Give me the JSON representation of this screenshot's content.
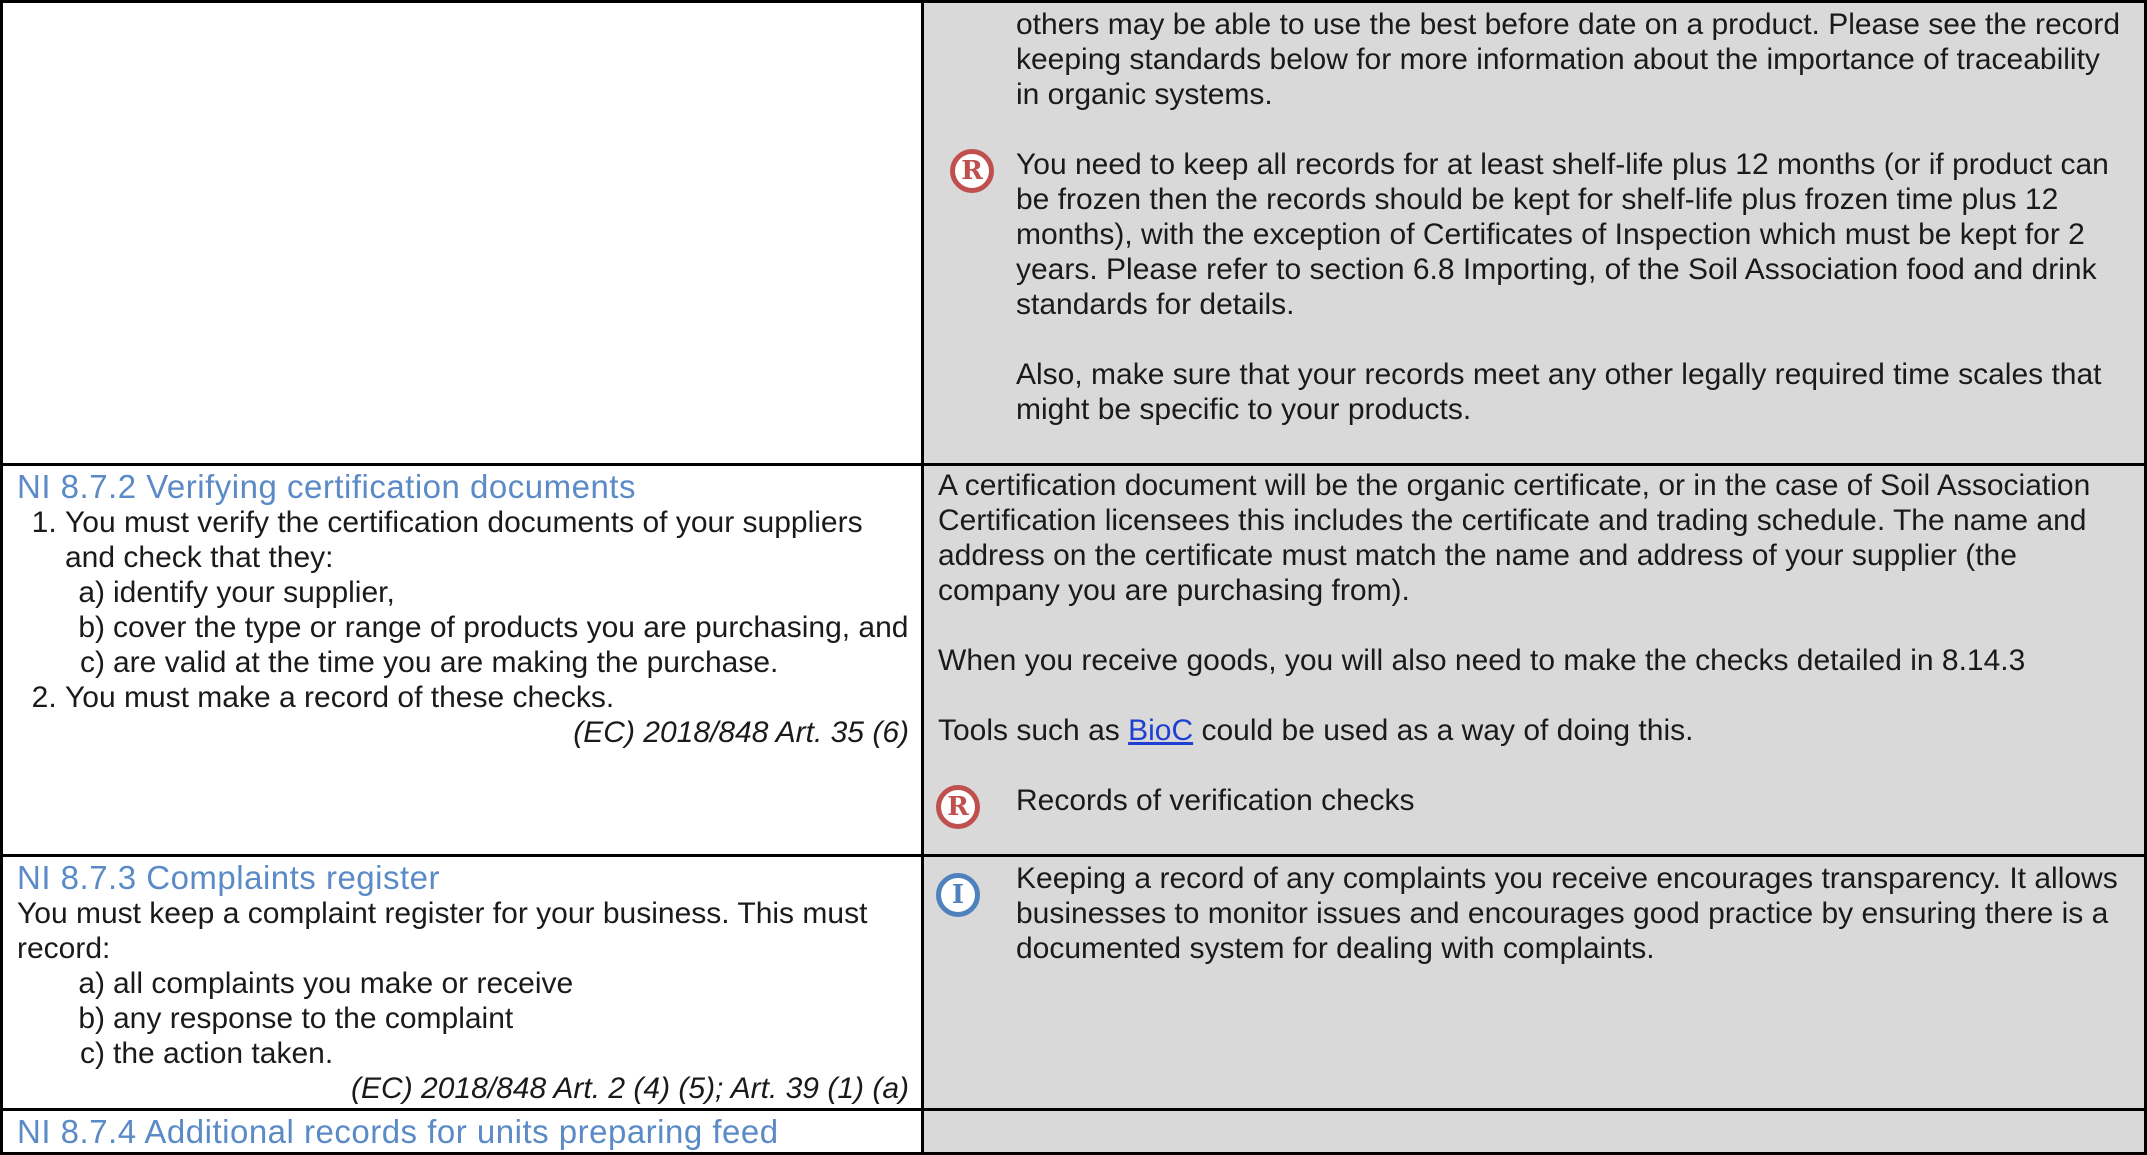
{
  "row1": {
    "right": {
      "p1": "others may be able to use the best before date on a product. Please see the record keeping standards below for more information about the importance of traceability in organic systems.",
      "r_icon": "R",
      "p2": "You need to keep all records for at least shelf-life plus 12 months (or if product can be frozen then the records should be kept for shelf-life plus frozen time plus 12 months), with the exception of Certificates of Inspection which must be kept for 2 years. Please refer to section 6.8 Importing, of the Soil Association food and drink standards for details.",
      "p3": "Also, make sure that your records meet any other legally required time scales that might be specific to your products."
    }
  },
  "row2": {
    "heading": "NI 8.7.2 Verifying certification documents",
    "item1": "You must verify the certification documents of your suppliers and check that they:",
    "sub": [
      {
        "mark": "a)",
        "text": "identify your supplier,"
      },
      {
        "mark": "b)",
        "text": "cover the type or range of products you are purchasing, and"
      },
      {
        "mark": "c)",
        "text": "are valid at the time you are making the purchase."
      }
    ],
    "item2": "You must make a record of these checks.",
    "ref": "(EC) 2018/848 Art. 35 (6)",
    "right": {
      "p1": "A certification document will be the organic certificate, or in the case of Soil Association Certification licensees this includes the certificate and trading schedule. The name and address on the certificate must match the name and address of your supplier (the company you are purchasing from).",
      "p2": "When you receive goods, you will also need to make the checks detailed in 8.14.3",
      "p3_before": "Tools such as ",
      "p3_link": "BioC",
      "p3_after": " could be used as a way of doing this.",
      "r_icon": "R",
      "p4": "Records of verification checks"
    }
  },
  "row3": {
    "heading": "NI 8.7.3 Complaints register",
    "intro": "You must keep a complaint register for your business. This must record:",
    "sub": [
      {
        "mark": "a)",
        "text": "all complaints you make or receive"
      },
      {
        "mark": "b)",
        "text": "any response to the complaint"
      },
      {
        "mark": "c)",
        "text": "the action taken."
      }
    ],
    "ref": "(EC) 2018/848 Art. 2 (4) (5); Art. 39 (1) (a)",
    "right": {
      "i_icon": "I",
      "p1": "Keeping a record of any complaints you receive encourages transparency. It allows businesses to monitor issues and encourages good practice by ensuring there is a documented system for dealing with complaints."
    }
  },
  "row4": {
    "heading": "NI 8.7.4 Additional records for units preparing feed"
  },
  "colors": {
    "heading": "#5b8bc6",
    "record_icon": "#c0504d",
    "info_icon": "#4f81bd",
    "shaded": "#d9d9d9"
  }
}
